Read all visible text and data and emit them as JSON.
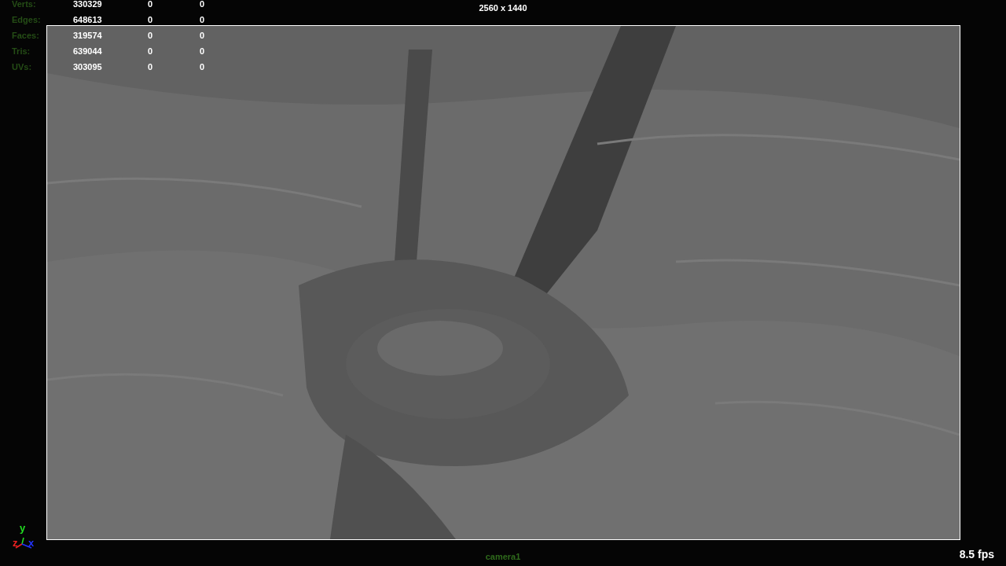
{
  "viewport": {
    "resolution": "2560 x 1440",
    "camera": "camera1",
    "fps": "8.5 fps"
  },
  "poly_count": [
    {
      "label": "Verts:",
      "values": [
        "330329",
        "0",
        "0"
      ]
    },
    {
      "label": "Edges:",
      "values": [
        "648613",
        "0",
        "0"
      ]
    },
    {
      "label": "Faces:",
      "values": [
        "319574",
        "0",
        "0"
      ]
    },
    {
      "label": "Tris:",
      "values": [
        "639044",
        "0",
        "0"
      ]
    },
    {
      "label": "UVs:",
      "values": [
        "303095",
        "0",
        "0"
      ]
    }
  ],
  "axes": [
    {
      "label": "y",
      "color": "#22dd22"
    },
    {
      "label": "z",
      "color": "#ee2222"
    },
    {
      "label": "x",
      "color": "#2233ff"
    }
  ]
}
